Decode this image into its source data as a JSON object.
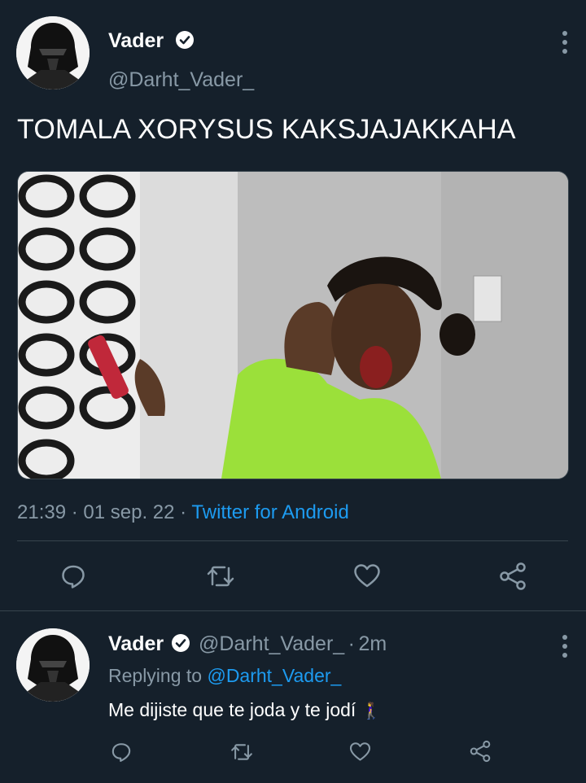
{
  "main_tweet": {
    "author_name": "Vader",
    "author_handle": "@Darht_Vader_",
    "text": "TOMALA XORYSUS KAKSJAJAKKAHA",
    "time": "21:39",
    "date": "01 sep. 22",
    "source": "Twitter for Android",
    "separator": "·"
  },
  "reply_tweet": {
    "author_name": "Vader",
    "author_handle": "@Darht_Vader_",
    "elapsed": "2m",
    "separator": "·",
    "replying_prefix": "Replying to",
    "replying_handle": "@Darht_Vader_",
    "text": "Me dijiste que te joda y te jodí",
    "emoji": "🚶‍♀️"
  },
  "colors": {
    "background": "#15202b",
    "accent": "#1d9bf0",
    "muted": "#8899a6"
  },
  "icons": [
    "verified-icon",
    "more-icon",
    "reply-icon",
    "retweet-icon",
    "like-icon",
    "share-icon"
  ]
}
